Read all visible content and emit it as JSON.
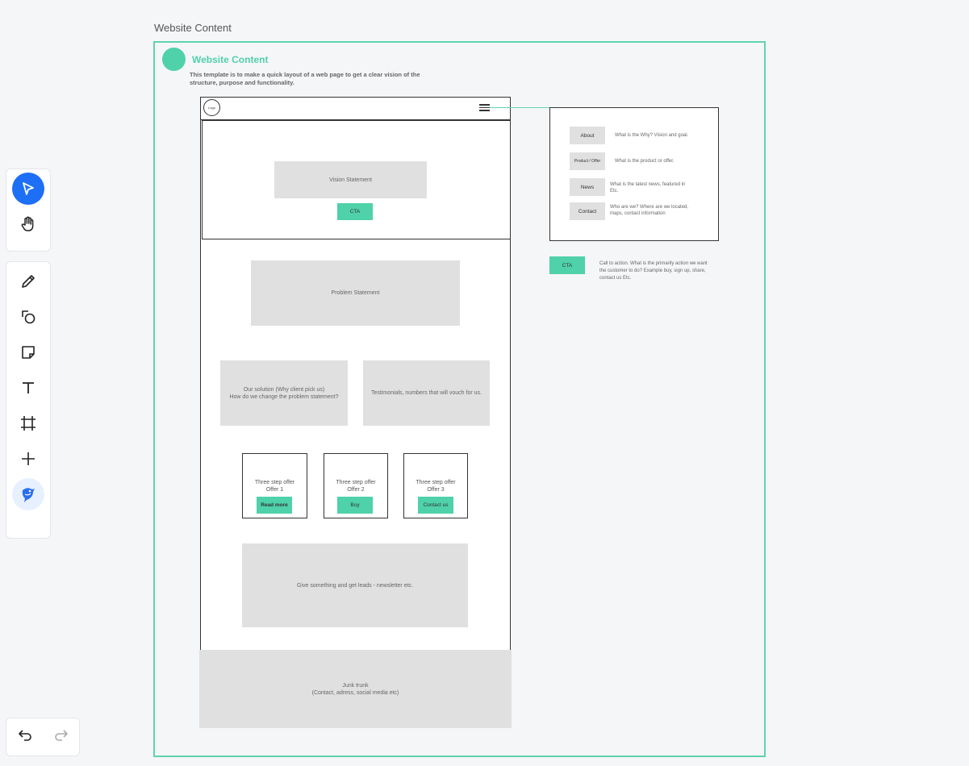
{
  "frame": {
    "title": "Website Content"
  },
  "header": {
    "title": "Website Content",
    "description": "This template is to make a quick layout of a web page to get a clear vision of the structure, purpose and functionality."
  },
  "wireframe": {
    "logo": "Logo",
    "vision": "Vision Statement",
    "cta": "CTA",
    "problem": "Problem Statement",
    "solution_line1": "Our solution (Why client pick us)",
    "solution_line2": "How do we change the problem statement?",
    "testimonials": "Testimonials, numbers that will vouch for us.",
    "offers": [
      {
        "line1": "Three step offer",
        "line2": "Offer 1",
        "button": "Read more"
      },
      {
        "line1": "Three step offer",
        "line2": "Offer 2",
        "button": "Buy"
      },
      {
        "line1": "Three step offer",
        "line2": "Offer 3",
        "button": "Contact us"
      }
    ],
    "leads": "Give something and get leads - newsletter etc.",
    "junk_line1": "Junk trunk",
    "junk_line2": "(Contact, adress, social media etc)"
  },
  "menu": {
    "items": [
      {
        "label": "About",
        "desc": "What is the Why? Vision and goal."
      },
      {
        "label": "Product / Offer",
        "desc": "What is the product or offer."
      },
      {
        "label": "News",
        "desc": "What is the latest news, featured in Etc."
      },
      {
        "label": "Contact",
        "desc": "Who are we? Where are we located, maps, contact information"
      }
    ]
  },
  "cta_note": {
    "label": "CTA",
    "desc": "Call to action. What is the primarily action we want the customer to do? Example buy, sign up, share, contact us Etc."
  },
  "colors": {
    "accent": "#4fd1a9",
    "active_tool": "#1d6ff5"
  }
}
